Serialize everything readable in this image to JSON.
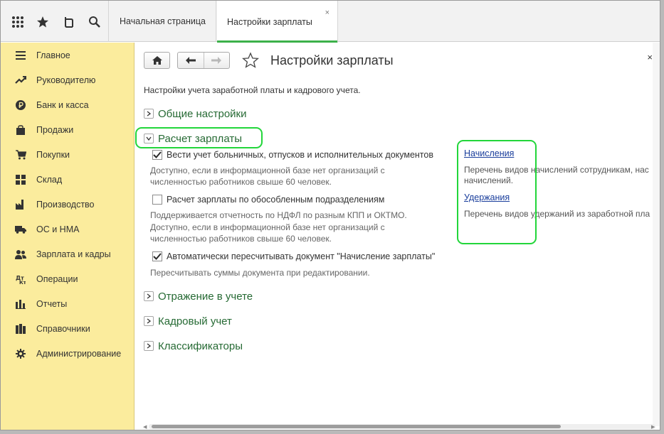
{
  "tabs": {
    "home": "Начальная страница",
    "active": "Настройки зарплаты",
    "close": "×"
  },
  "sidebar": {
    "items": [
      {
        "label": "Главное",
        "icon": "menu-icon"
      },
      {
        "label": "Руководителю",
        "icon": "trend-icon"
      },
      {
        "label": "Банк и касса",
        "icon": "ruble-icon"
      },
      {
        "label": "Продажи",
        "icon": "bag-icon"
      },
      {
        "label": "Покупки",
        "icon": "cart-icon"
      },
      {
        "label": "Склад",
        "icon": "warehouse-icon"
      },
      {
        "label": "Производство",
        "icon": "factory-icon"
      },
      {
        "label": "ОС и НМА",
        "icon": "truck-icon"
      },
      {
        "label": "Зарплата и кадры",
        "icon": "people-icon"
      },
      {
        "label": "Операции",
        "icon": "operations-icon"
      },
      {
        "label": "Отчеты",
        "icon": "bar-chart-icon"
      },
      {
        "label": "Справочники",
        "icon": "books-icon"
      },
      {
        "label": "Администрирование",
        "icon": "gear-icon"
      }
    ]
  },
  "page": {
    "title": "Настройки зарплаты",
    "close": "×",
    "subtitle": "Настройки учета заработной платы и кадрового учета."
  },
  "sections": {
    "general": "Общие настройки",
    "salary": "Расчет зарплаты",
    "reflection": "Отражение в учете",
    "hr": "Кадровый учет",
    "classifiers": "Классификаторы"
  },
  "salary": {
    "option1": {
      "label": "Вести учет больничных, отпусков и исполнительных документов",
      "checked": true
    },
    "hint1_line1": "Доступно, если в информационной базе нет организаций с",
    "hint1_line2": "численностью работников свыше 60 человек.",
    "option2": {
      "label": "Расчет зарплаты по обособленным подразделениям",
      "checked": false
    },
    "hint2_line1": "Поддерживается отчетность по НДФЛ по разным КПП и ОКТМО.",
    "hint2_line2": "Доступно, если в информационной базе нет организаций с",
    "hint2_line3": "численностью работников свыше 60 человек.",
    "option3": {
      "label": "Автоматически пересчитывать документ \"Начисление зарплаты\"",
      "checked": true
    },
    "hint3": "Пересчитывать суммы документа при редактировании."
  },
  "links": {
    "accruals": "Начисления",
    "accruals_hint_line1": "Перечень видов начислений сотрудникам, нас",
    "accruals_hint_line2": "начислений.",
    "deductions": "Удержания",
    "deductions_hint": "Перечень видов удержаний из заработной пла"
  },
  "colors": {
    "sidebar_bg": "#fbec9d",
    "section_title": "#266a34",
    "link": "#1a3e9c",
    "highlight": "#22d63a",
    "active_tab_accent": "#3cb14a"
  }
}
